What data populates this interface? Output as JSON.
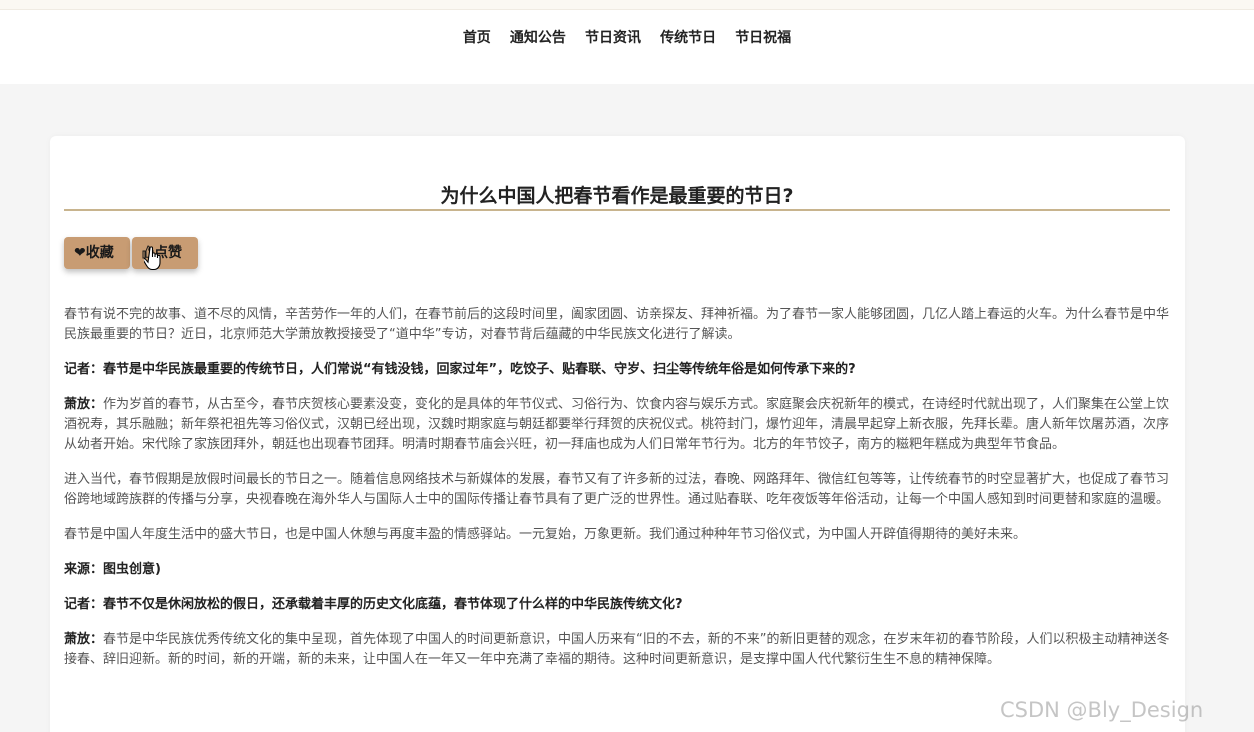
{
  "nav": {
    "items": [
      "首页",
      "通知公告",
      "节日资讯",
      "传统节日",
      "节日祝福"
    ]
  },
  "article": {
    "title": "为什么中国人把春节看作是最重要的节日?",
    "buttons": {
      "favorite": "收藏",
      "like": "点赞"
    },
    "p1": "春节有说不完的故事、道不尽的风情，辛苦劳作一年的人们，在春节前后的这段时间里，阖家团圆、访亲探友、拜神祈福。为了春节一家人能够团圆，几亿人踏上春运的火车。为什么春节是中华民族最重要的节日？近日，北京师范大学萧放教授接受了“道中华”专访，对春节背后蕴藏的中华民族文化进行了解读。",
    "q1": "记者：春节是中华民族最重要的传统节日，人们常说“有钱没钱，回家过年”，吃饺子、贴春联、守岁、扫尘等传统年俗是如何传承下来的?",
    "a1_speaker": "萧放：",
    "a1": "作为岁首的春节，从古至今，春节庆贺核心要素没变，变化的是具体的年节仪式、习俗行为、饮食内容与娱乐方式。家庭聚会庆祝新年的模式，在诗经时代就出现了，人们聚集在公堂上饮酒祝寿，其乐融融；新年祭祀祖先等习俗仪式，汉朝已经出现，汉魏时期家庭与朝廷都要举行拜贺的庆祝仪式。桃符封门，爆竹迎年，清晨早起穿上新衣服，先拜长辈。唐人新年饮屠苏酒，次序从幼者开始。宋代除了家族团拜外，朝廷也出现春节团拜。明清时期春节庙会兴旺，初一拜庙也成为人们日常年节行为。北方的年节饺子，南方的糍粑年糕成为典型年节食品。",
    "p2": "进入当代，春节假期是放假时间最长的节日之一。随着信息网络技术与新媒体的发展，春节又有了许多新的过法，春晚、网路拜年、微信红包等等，让传统春节的时空显著扩大，也促成了春节习俗跨地域跨族群的传播与分享，央视春晚在海外华人与国际人士中的国际传播让春节具有了更广泛的世界性。通过贴春联、吃年夜饭等年俗活动，让每一个中国人感知到时间更替和家庭的温暖。",
    "p3": "春节是中国人年度生活中的盛大节日，也是中国人休憩与再度丰盈的情感驿站。一元复始，万象更新。我们通过种种年节习俗仪式，为中国人开辟值得期待的美好未来。",
    "source": "来源：图虫创意)",
    "q2": "记者：春节不仅是休闲放松的假日，还承载着丰厚的历史文化底蕴，春节体现了什么样的中华民族传统文化?",
    "a2_speaker": "萧放：",
    "a2": "春节是中华民族优秀传统文化的集中呈现，首先体现了中国人的时间更新意识，中国人历来有“旧的不去，新的不来”的新旧更替的观念，在岁末年初的春节阶段，人们以积极主动精神送冬接春、辞旧迎新。新的时间，新的开端，新的未来，让中国人在一年又一年中充满了幸福的期待。这种时间更新意识，是支撑中国人代代繁衍生生不息的精神保障。"
  },
  "watermark": "CSDN @Bly_Design",
  "colors": {
    "accent": "#c89c73",
    "rule": "#c8b48e"
  }
}
